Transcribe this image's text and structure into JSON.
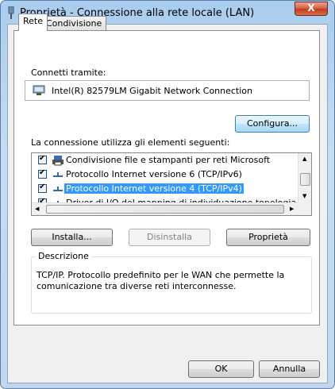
{
  "window": {
    "title": "Proprietà - Connessione alla rete locale (LAN)",
    "close_label": "X"
  },
  "tabs": [
    {
      "label": "Rete",
      "active": true
    },
    {
      "label": "Condivisione",
      "active": false
    }
  ],
  "connect_via": {
    "label": "Connetti tramite:",
    "adapter": "Intel(R) 82579LM Gigabit Network Connection"
  },
  "configure_button": "Configura...",
  "items_label": "La connessione utilizza gli elementi seguenti:",
  "items": [
    {
      "label": "Condivisione file e stampanti per reti Microsoft",
      "checked": true,
      "selected": false
    },
    {
      "label": "Protocollo Internet versione 6 (TCP/IPv6)",
      "checked": true,
      "selected": false
    },
    {
      "label": "Protocollo Internet versione 4 (TCP/IPv4)",
      "checked": true,
      "selected": true
    },
    {
      "label": "Driver di I/O del mapping di individuazione topologia liv",
      "checked": true,
      "selected": false
    }
  ],
  "buttons": {
    "install": "Installa...",
    "uninstall": "Disinstalla",
    "properties": "Proprietà",
    "ok": "OK",
    "cancel": "Annulla"
  },
  "description": {
    "title": "Descrizione",
    "text": "TCP/IP. Protocollo predefinito per le WAN che permette la comunicazione tra diverse reti interconnesse."
  },
  "colors": {
    "selection": "#3399ff",
    "window_frame": "#a9cdef",
    "close_button": "#c13b1f"
  }
}
